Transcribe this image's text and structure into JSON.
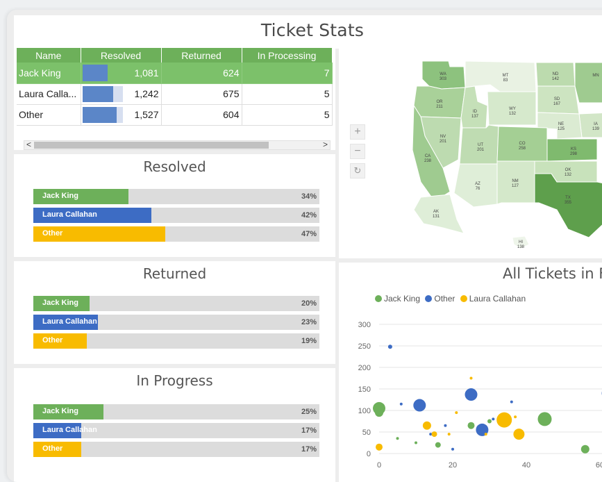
{
  "page": {
    "title": "Ticket Stats"
  },
  "colors": {
    "jack": "#6db05a",
    "laura": "#3d6cc4",
    "other": "#f8bb00",
    "header_green": "#6db05a",
    "selected_green": "#7cc16a"
  },
  "grid": {
    "columns": [
      "Name",
      "Resolved",
      "Returned",
      "In Processing"
    ],
    "rows": [
      {
        "name": "Jack King",
        "resolved": "1,081",
        "returned": "624",
        "processing": "7",
        "resolved_fraction": 0.34
      },
      {
        "name": "Laura Calla...",
        "resolved": "1,242",
        "returned": "675",
        "processing": "5",
        "resolved_fraction": 0.42
      },
      {
        "name": "Other",
        "resolved": "1,527",
        "returned": "604",
        "processing": "5",
        "resolved_fraction": 0.47
      }
    ],
    "scroll_left": "<",
    "scroll_right": ">"
  },
  "resolved": {
    "title": "Resolved",
    "items": [
      {
        "label": "Jack King",
        "pct": "34%",
        "value": 34
      },
      {
        "label": "Laura Callahan",
        "pct": "42%",
        "value": 42
      },
      {
        "label": "Other",
        "pct": "47%",
        "value": 47
      }
    ]
  },
  "returned": {
    "title": "Returned",
    "items": [
      {
        "label": "Jack King",
        "pct": "20%",
        "value": 20
      },
      {
        "label": "Laura Callahan",
        "pct": "23%",
        "value": 23
      },
      {
        "label": "Other",
        "pct": "19%",
        "value": 19
      }
    ]
  },
  "in_progress": {
    "title": "In Progress",
    "items": [
      {
        "label": "Jack King",
        "pct": "25%",
        "value": 25
      },
      {
        "label": "Laura Callahan",
        "pct": "17%",
        "value": 17
      },
      {
        "label": "Other",
        "pct": "17%",
        "value": 17
      }
    ]
  },
  "map": {
    "zoom_in": "+",
    "zoom_out": "−",
    "reset": "↻",
    "states": [
      {
        "abbr": "WA",
        "value": "303"
      },
      {
        "abbr": "MT",
        "value": "83"
      },
      {
        "abbr": "ND",
        "value": "142"
      },
      {
        "abbr": "MN",
        "value": ""
      },
      {
        "abbr": "OR",
        "value": "211"
      },
      {
        "abbr": "ID",
        "value": "137"
      },
      {
        "abbr": "WY",
        "value": "132"
      },
      {
        "abbr": "SD",
        "value": "167"
      },
      {
        "abbr": "IA",
        "value": "139"
      },
      {
        "abbr": "NE",
        "value": "125"
      },
      {
        "abbr": "NV",
        "value": "201"
      },
      {
        "abbr": "UT",
        "value": "201"
      },
      {
        "abbr": "CO",
        "value": "258"
      },
      {
        "abbr": "KS",
        "value": "298"
      },
      {
        "abbr": "CA",
        "value": "238"
      },
      {
        "abbr": "AZ",
        "value": "76"
      },
      {
        "abbr": "NM",
        "value": "127"
      },
      {
        "abbr": "OK",
        "value": "132"
      },
      {
        "abbr": "TX",
        "value": "355"
      },
      {
        "abbr": "AK",
        "value": "131"
      },
      {
        "abbr": "HI",
        "value": "138"
      }
    ]
  },
  "chart_data": {
    "type": "scatter",
    "title": "All Tickets in F",
    "legend": [
      "Jack King",
      "Other",
      "Laura Callahan"
    ],
    "xlim": [
      0,
      62
    ],
    "ylim": [
      0,
      300
    ],
    "x_ticks": [
      "0",
      "20",
      "40",
      "60"
    ],
    "y_ticks": [
      "0",
      "50",
      "100",
      "150",
      "200",
      "250",
      "300"
    ],
    "series": [
      {
        "name": "Jack King",
        "points": [
          [
            0,
            105,
            9
          ],
          [
            0,
            95,
            6
          ],
          [
            25,
            65,
            5
          ],
          [
            16,
            20,
            4
          ],
          [
            30,
            75,
            3
          ],
          [
            45,
            80,
            10
          ],
          [
            56,
            10,
            6
          ],
          [
            5,
            35,
            2
          ],
          [
            10,
            25,
            2
          ]
        ]
      },
      {
        "name": "Other",
        "points": [
          [
            3,
            248,
            3
          ],
          [
            25,
            137,
            9
          ],
          [
            11,
            112,
            9
          ],
          [
            28,
            55,
            9
          ],
          [
            62,
            140,
            8
          ],
          [
            6,
            115,
            2
          ],
          [
            36,
            120,
            2
          ],
          [
            18,
            65,
            2
          ],
          [
            14,
            45,
            2
          ],
          [
            20,
            10,
            2
          ],
          [
            31,
            80,
            2
          ]
        ]
      },
      {
        "name": "Laura Callahan",
        "points": [
          [
            34,
            78,
            11
          ],
          [
            38,
            45,
            8
          ],
          [
            13,
            65,
            6
          ],
          [
            15,
            45,
            4
          ],
          [
            0,
            15,
            5
          ],
          [
            25,
            175,
            2
          ],
          [
            21,
            95,
            2
          ],
          [
            29,
            45,
            2
          ],
          [
            37,
            85,
            2
          ],
          [
            19,
            45,
            2
          ]
        ]
      }
    ]
  }
}
